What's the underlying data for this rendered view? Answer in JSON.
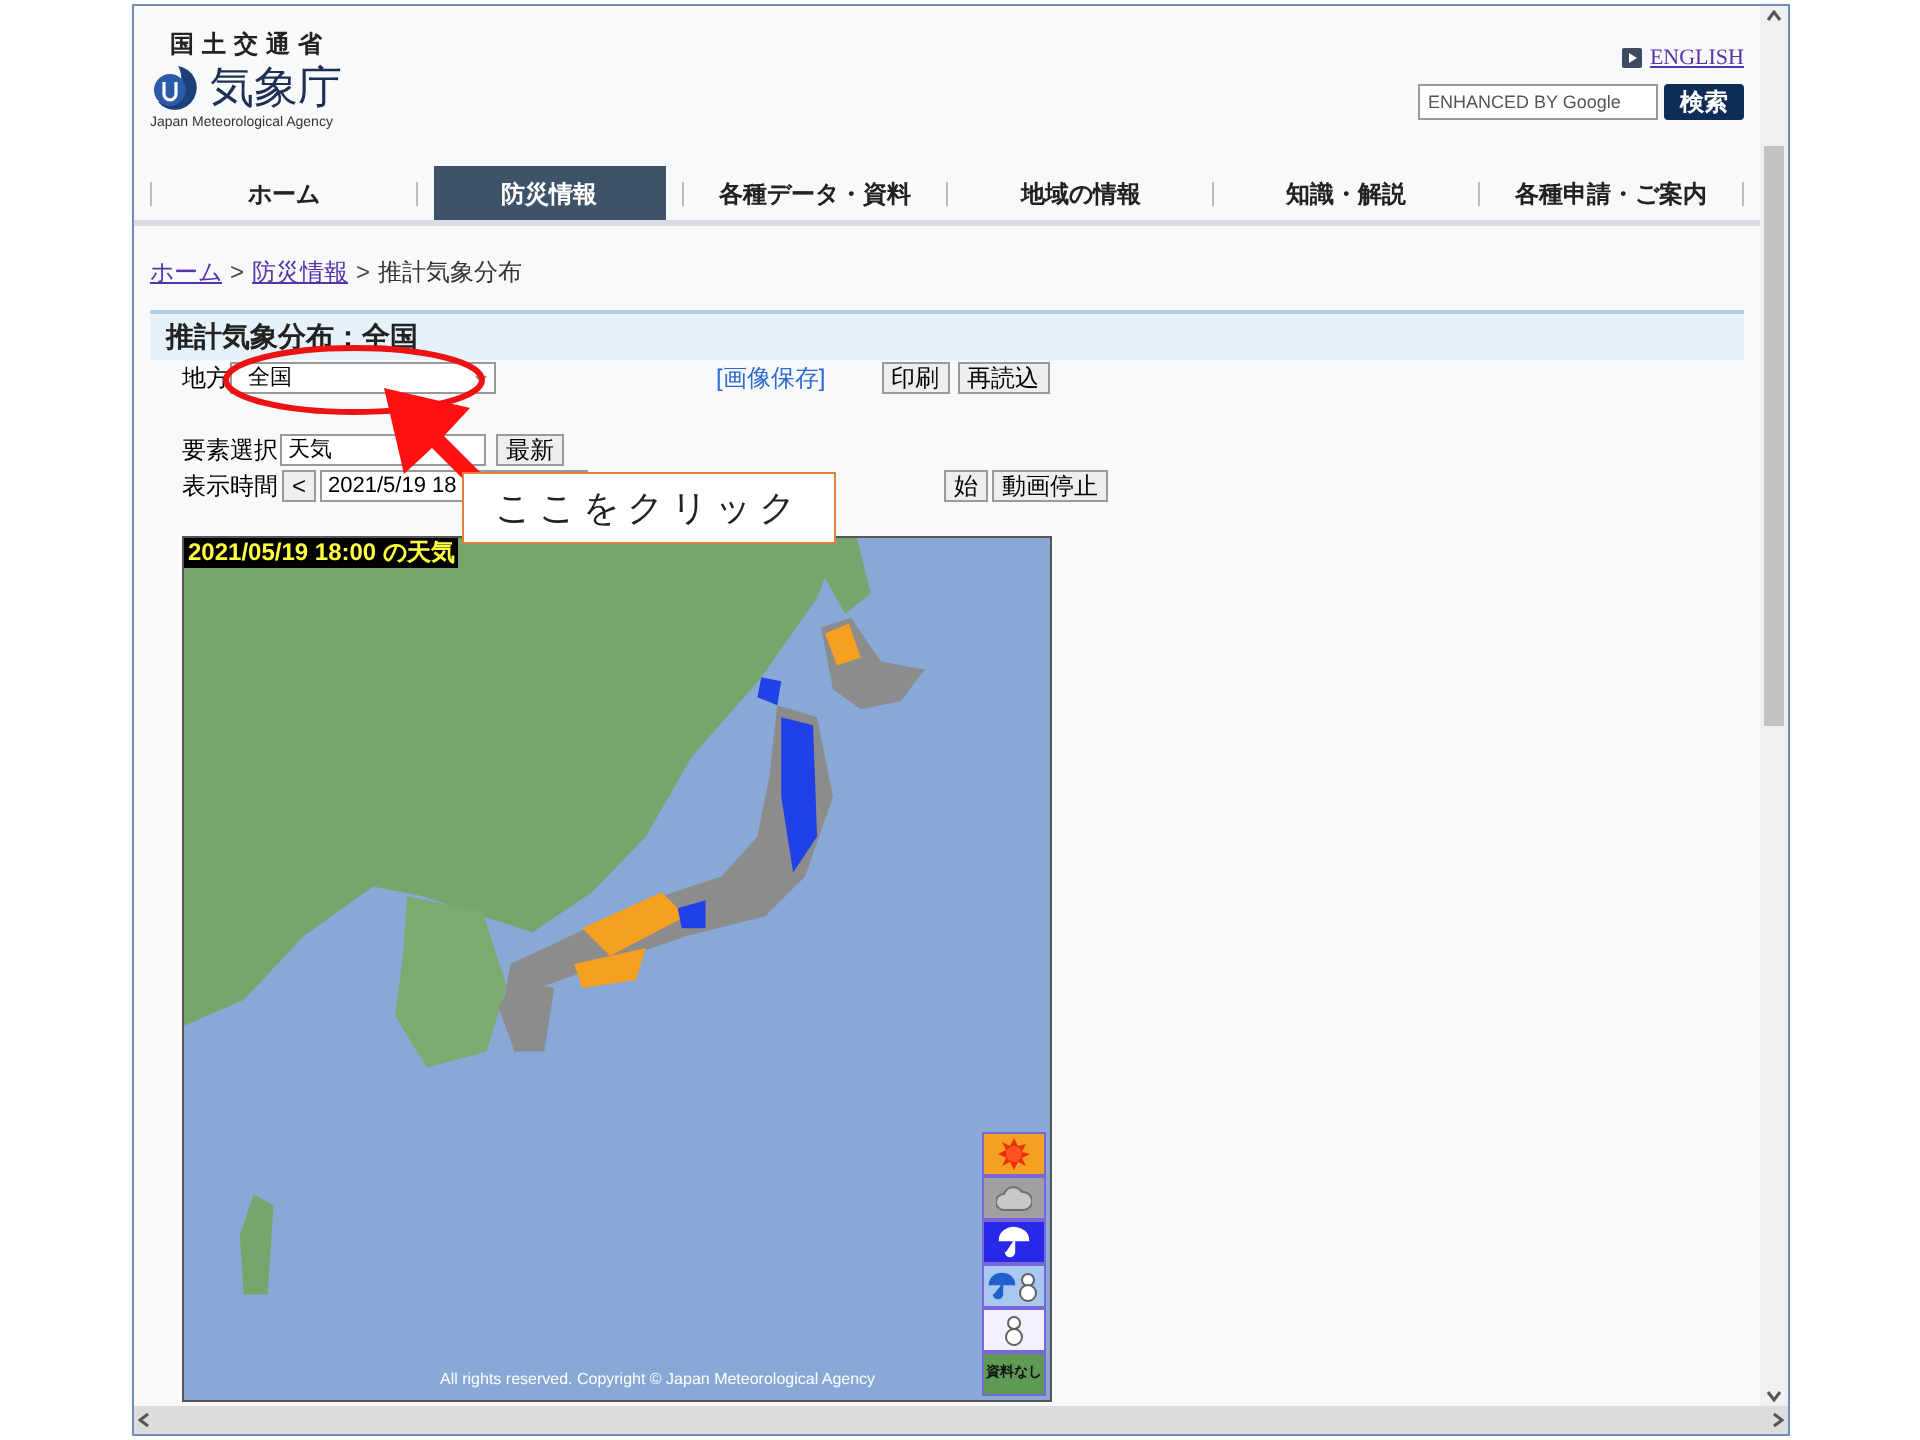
{
  "header": {
    "ministry": "国土交通省",
    "logo_text": "気象庁",
    "logo_subtitle": "Japan Meteorological Agency",
    "english_link": "ENGLISH",
    "search": {
      "placeholder": "ENHANCED BY Google",
      "button": "検索"
    }
  },
  "nav": [
    {
      "label": "ホーム",
      "selected": false
    },
    {
      "label": "防災情報",
      "selected": true
    },
    {
      "label": "各種データ・資料",
      "selected": false
    },
    {
      "label": "地域の情報",
      "selected": false
    },
    {
      "label": "知識・解説",
      "selected": false
    },
    {
      "label": "各種申請・ご案内",
      "selected": false
    }
  ],
  "breadcrumb": [
    {
      "label": "ホーム",
      "link": true
    },
    {
      "label": "防災情報",
      "link": true
    },
    {
      "label": "推計気象分布",
      "link": false
    }
  ],
  "breadcrumb_separator": ">",
  "panel": {
    "title": "推計気象分布：全国",
    "region": {
      "label": "地方",
      "value": "全国"
    },
    "save_link": "[画像保存]",
    "buttons": [
      "印刷",
      "再読込"
    ],
    "element": {
      "label": "要素選択",
      "value": "天気",
      "button": "最新"
    },
    "time": {
      "label": "表示時間",
      "prev_button": "<",
      "value": "2021/5/19 18",
      "buttons": [
        "始",
        "動画停止"
      ]
    }
  },
  "map": {
    "timestamp": "2021/05/19 18:00 の天気",
    "copyright": "All rights reserved. Copyright © Japan Meteorological Agency",
    "legend": [
      {
        "kind": "sunny",
        "color": "#f5a020"
      },
      {
        "kind": "cloudy",
        "color": "#a0a0a0"
      },
      {
        "kind": "rain",
        "color": "#2828e8"
      },
      {
        "kind": "rain-snow",
        "color": "#a8c8f0"
      },
      {
        "kind": "snow",
        "color": "#f2f2ff"
      },
      {
        "kind": "no-data",
        "label": "資料なし",
        "color": "#5f9a55"
      }
    ]
  },
  "annotation": {
    "callout": "ここをクリック"
  }
}
